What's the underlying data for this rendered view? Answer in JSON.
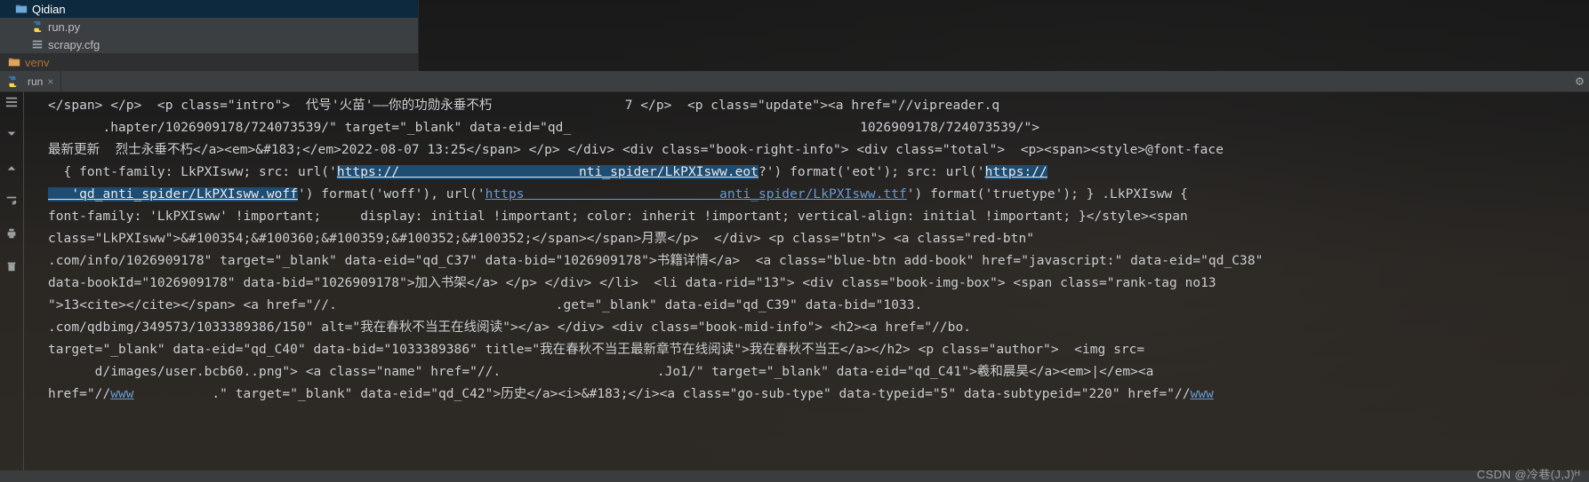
{
  "project": {
    "folder": "Qidian",
    "files": [
      "run.py",
      "scrapy.cfg"
    ],
    "venv": "venv"
  },
  "tabs": {
    "active": "run",
    "close": "×"
  },
  "icons": {
    "gear": "⚙"
  },
  "watermark": "CSDN @冷巷(J,J)ᴴ",
  "code": {
    "line1": "</span> </p>  <p class=\"intro\">  代号'火苗'——你的功勋永垂不朽                 7 </p>  <p class=\"update\"><a href=\"//vipreader.q",
    "line2_a": "       .hapter/1026909178/724073539/\" target=\"_blank\" data-eid=\"qd_                                     ",
    "line2_b": "1026909178/724073539/\">",
    "line3": "最新更新  烈士永垂不朽</a><em>&#183;</em>2022-08-07 13:25</span> </p> </div> <div class=\"book-right-info\"> <div class=\"total\">  <p><span><style>@font-face",
    "line4_a": "  { font-family: LkPXIsww; src: url('",
    "line4_link1": "https://                       nti_spider/LkPXIsww.eot",
    "line4_b": "?') format('eot'); src: url('",
    "line4_link2": "https://",
    "line5_link1": "   'qd_anti_spider/LkPXIsww.woff",
    "line5_a": "') format('woff'), url('",
    "line5_link2": "https                         anti_spider/LkPXIsww.ttf",
    "line5_b": "') format('truetype'); } .LkPXIsww {",
    "line6": "font-family: 'LkPXIsww' !important;     display: initial !important; color: inherit !important; vertical-align: initial !important; }</style><span",
    "line7": "class=\"LkPXIsww\">&#100354;&#100360;&#100359;&#100352;&#100352;</span></span>月票</p>  </div> <p class=\"btn\"> <a class=\"red-btn\"             ",
    "line8": ".com/info/1026909178\" target=\"_blank\" data-eid=\"qd_C37\" data-bid=\"1026909178\">书籍详情</a>  <a class=\"blue-btn add-book\" href=\"javascript:\" data-eid=\"qd_C38\"",
    "line9": "data-bookId=\"1026909178\" data-bid=\"1026909178\">加入书架</a> </p> </div> </li>  <li data-rid=\"13\"> <div class=\"book-img-box\"> <span class=\"rank-tag no13",
    "line10": "\">13<cite></cite></span> <a href=\"//.                            .get=\"_blank\" data-eid=\"qd_C39\" data-bid=\"1033.                      ",
    "line11": ".com/qdbimg/349573/1033389386/150\" alt=\"我在春秋不当王在线阅读\"></a> </div> <div class=\"book-mid-info\"> <h2><a href=\"//bo.         ",
    "line12": "target=\"_blank\" data-eid=\"qd_C40\" data-bid=\"1033389386\" title=\"我在春秋不当王最新章节在线阅读\">我在春秋不当王</a></h2> <p class=\"author\">  <img src=",
    "line13": "      d/images/user.bcb60..png\"> <a class=\"name\" href=\"//.                    .Jo1/\" target=\"_blank\" data-eid=\"qd_C41\">羲和晨昊</a><em>|</em><a",
    "line14_a": "href=\"//",
    "line14_link": "www",
    "line14_b": "          .\" target=\"_blank\" data-eid=\"qd_C42\">历史</a><i>&#183;</i><a class=\"go-sub-type\" data-typeid=\"5\" data-subtypeid=\"220\" href=\"//",
    "line14_link2": "www"
  }
}
